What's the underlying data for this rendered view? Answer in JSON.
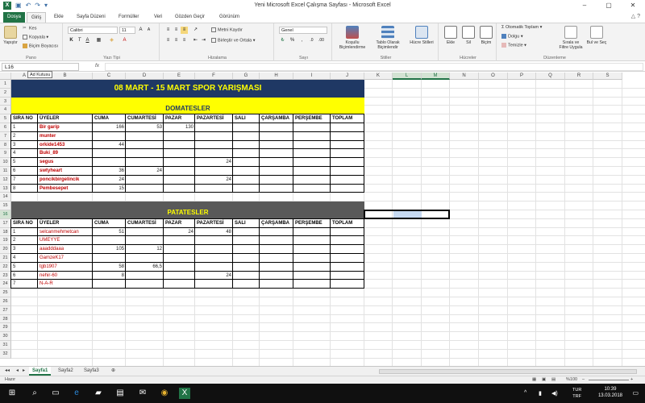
{
  "window": {
    "title": "Yeni Microsoft Excel Çalışma Sayfası - Microsoft Excel",
    "controls": [
      "–",
      "▢",
      "✕"
    ]
  },
  "tabs": [
    "Dosya",
    "Giriş",
    "Ekle",
    "Sayfa Düzeni",
    "Formüller",
    "Veri",
    "Gözden Geçir",
    "Görünüm"
  ],
  "ribbon": {
    "clipboard": {
      "paste": "Yapıştır",
      "cut": "Kes",
      "copy": "Kopyala",
      "format_painter": "Biçim Boyacısı",
      "group": "Pano"
    },
    "font": {
      "name": "Calibri",
      "size": "11",
      "group": "Yazı Tipi"
    },
    "alignment": {
      "wrap": "Metni Kaydır",
      "merge": "Birleştir ve Ortala",
      "group": "Hizalama"
    },
    "number": {
      "format": "Genel",
      "group": "Sayı"
    },
    "styles": {
      "conditional": "Koşullu Biçimlendirme",
      "table": "Tablo Olarak Biçimlendir",
      "cell_styles": "Hücre Stilleri",
      "group": "Stiller"
    },
    "cells": {
      "insert": "Ekle",
      "delete": "Sil",
      "format": "Biçim",
      "group": "Hücreler"
    },
    "editing": {
      "autosum": "Otomatik Toplam",
      "fill": "Dolgu",
      "clear": "Temizle",
      "sort": "Sırala ve Filtre Uygula",
      "find": "Bul ve Seç",
      "group": "Düzenleme"
    }
  },
  "formula_bar": {
    "name_box": "L16",
    "fx": "fx",
    "tooltip": "Ad Kutusu"
  },
  "grid": {
    "columns": [
      "A",
      "B",
      "C",
      "D",
      "E",
      "F",
      "G",
      "H",
      "I",
      "J",
      "K",
      "L",
      "M",
      "N",
      "O",
      "P",
      "Q",
      "R",
      "S"
    ],
    "rows": [
      "1",
      "2",
      "3",
      "4",
      "5",
      "6",
      "7",
      "8",
      "9",
      "10",
      "11",
      "12",
      "13",
      "14",
      "15",
      "16",
      "17",
      "18",
      "19",
      "20",
      "21",
      "22",
      "23",
      "24",
      "25",
      "26",
      "27",
      "28",
      "29",
      "30",
      "31",
      "32"
    ],
    "title": "08 MART - 15 MART SPOR YARIŞMASI",
    "section1": "DOMATESLER",
    "section2": "PATATESLER",
    "headers": [
      "SIRA NO",
      "ÜYELER",
      "CUMA",
      "CUMARTESİ",
      "PAZAR",
      "PAZARTESİ",
      "SALI",
      "ÇARŞAMBA",
      "PERŞEMBE",
      "TOPLAM"
    ],
    "table1": [
      [
        "1",
        "Bir garip",
        "166",
        "53",
        "130",
        "",
        "",
        "",
        "",
        ""
      ],
      [
        "2",
        "munter",
        "",
        "",
        "",
        "",
        "",
        "",
        "",
        ""
      ],
      [
        "3",
        "orkide1453",
        "44",
        "",
        "",
        "",
        "",
        "",
        "",
        ""
      ],
      [
        "4",
        "Buki_89",
        "",
        "",
        "",
        "",
        "",
        "",
        "",
        ""
      ],
      [
        "5",
        "segus",
        "",
        "",
        "",
        "24",
        "",
        "",
        "",
        ""
      ],
      [
        "6",
        "swtyheart",
        "36",
        "24",
        "",
        "",
        "",
        "",
        "",
        ""
      ],
      [
        "7",
        "poncikbirgelincik",
        "24",
        "",
        "",
        "24",
        "",
        "",
        "",
        ""
      ],
      [
        "8",
        "Pembesepet",
        "15",
        "",
        "",
        "",
        "",
        "",
        "",
        ""
      ]
    ],
    "table2": [
      [
        "1",
        "selcanmehmetcan",
        "51",
        "",
        "24",
        "48",
        "",
        "",
        "",
        ""
      ],
      [
        "2",
        "UMEYYE",
        "",
        "",
        "",
        "",
        "",
        "",
        "",
        ""
      ],
      [
        "3",
        "aaadddaaa",
        "105",
        "12",
        "",
        "",
        "",
        "",
        "",
        ""
      ],
      [
        "4",
        "GamzeK17",
        "",
        "",
        "",
        "",
        "",
        "",
        "",
        ""
      ],
      [
        "5",
        "tgb1907",
        "58",
        "66,5",
        "",
        "",
        "",
        "",
        "",
        ""
      ],
      [
        "6",
        "nehir-60",
        "8",
        "",
        "",
        "24",
        "",
        "",
        "",
        ""
      ],
      [
        "7",
        "N-A-R",
        "",
        "",
        "",
        "",
        "",
        "",
        "",
        ""
      ]
    ]
  },
  "sheets": [
    "Sayfa1",
    "Sayfa2",
    "Sayfa3"
  ],
  "status": {
    "ready": "Hazır",
    "zoom": "%100"
  },
  "taskbar": {
    "lang": "TUR",
    "kb": "TRF",
    "time": "10:39",
    "date": "13.03.2018"
  }
}
